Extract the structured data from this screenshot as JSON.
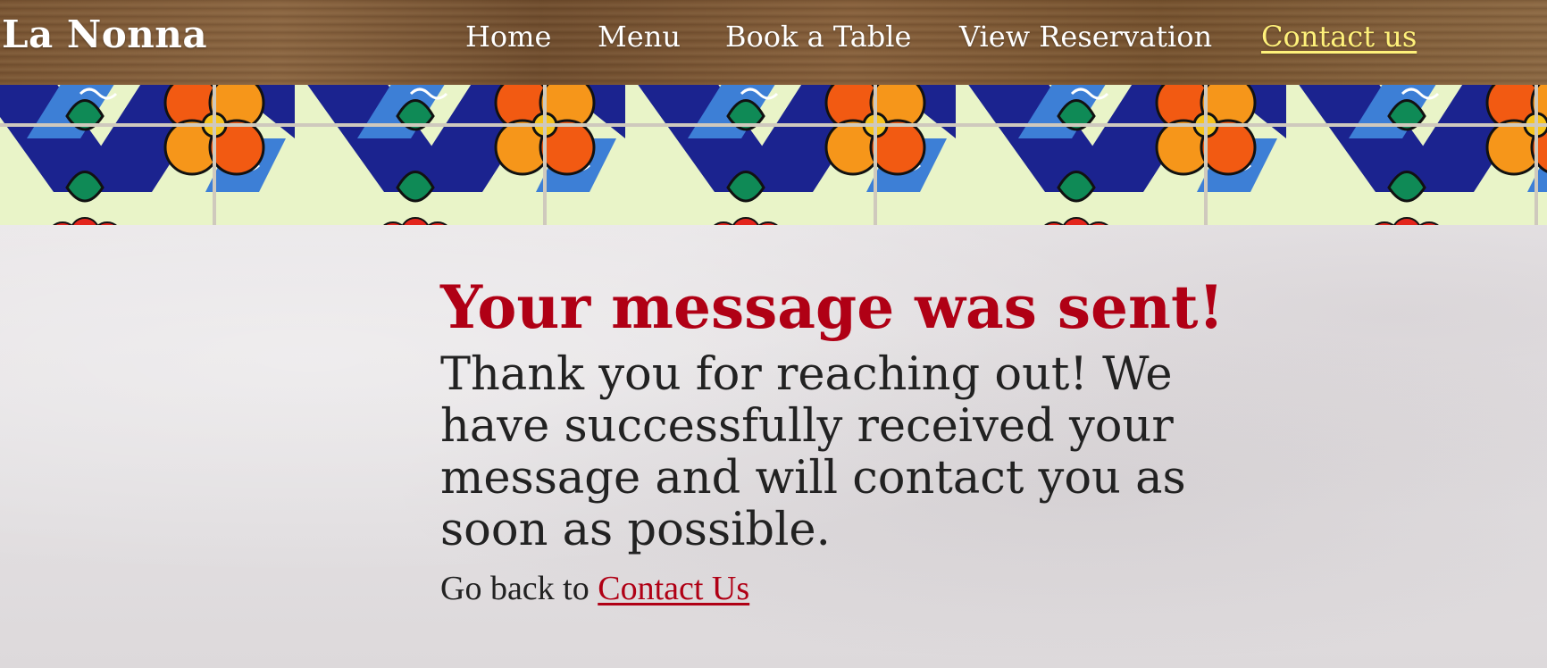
{
  "navbar": {
    "brand": "La Nonna",
    "links": [
      {
        "label": "Home",
        "active": false
      },
      {
        "label": "Menu",
        "active": false
      },
      {
        "label": "Book a Table",
        "active": false
      },
      {
        "label": "View Reservation",
        "active": false
      },
      {
        "label": "Contact us",
        "active": true
      }
    ]
  },
  "message": {
    "title": "Your message was sent!",
    "body": "Thank you for reaching out! We have successfully received your message and will contact you as soon as possible.",
    "back_prefix": "Go back to ",
    "back_link": "Contact Us"
  },
  "colors": {
    "accent_red": "#b00015",
    "active_nav": "#fff17a",
    "body_text": "#222222"
  }
}
